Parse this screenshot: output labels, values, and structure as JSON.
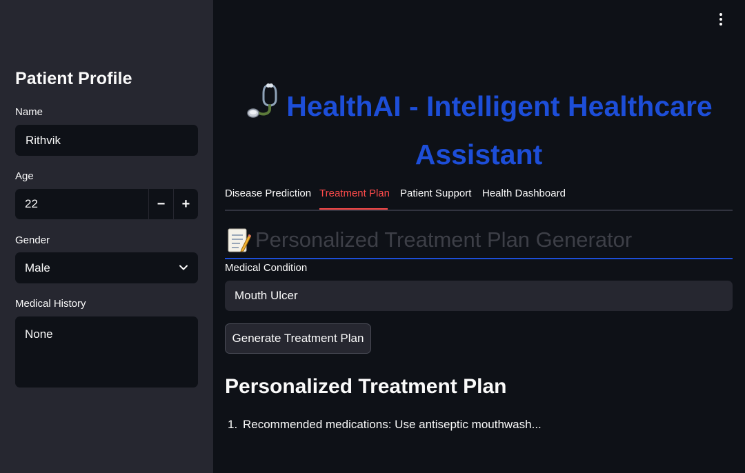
{
  "sidebar": {
    "title": "Patient Profile",
    "name_label": "Name",
    "name_value": "Rithvik",
    "age_label": "Age",
    "age_value": "22",
    "age_decrement": "−",
    "age_increment": "+",
    "gender_label": "Gender",
    "gender_value": "Male",
    "history_label": "Medical History",
    "history_value": "None"
  },
  "header": {
    "title_line1": "HealthAI - Intelligent Healthcare",
    "title_line2": "Assistant",
    "title_color": "#1d4ed8",
    "icon": "stethoscope-icon"
  },
  "tabs": [
    {
      "label": "Disease Prediction"
    },
    {
      "label": "Treatment Plan"
    },
    {
      "label": "Patient Support"
    },
    {
      "label": "Health Dashboard"
    }
  ],
  "active_tab": "Treatment Plan",
  "section": {
    "icon": "memo-icon",
    "heading": "Personalized Treatment Plan Generator",
    "condition_label": "Medical Condition",
    "condition_value": "Mouth Ulcer",
    "generate_button": "Generate Treatment Plan",
    "result_title": "Personalized Treatment Plan",
    "result_items": [
      {
        "number": "1.",
        "text": "Recommended medications: Use antiseptic mouthwash..."
      }
    ]
  },
  "colors": {
    "accent_tab": "#ff4b4b",
    "sidebar_bg": "#262730",
    "main_bg": "#0e1117"
  }
}
